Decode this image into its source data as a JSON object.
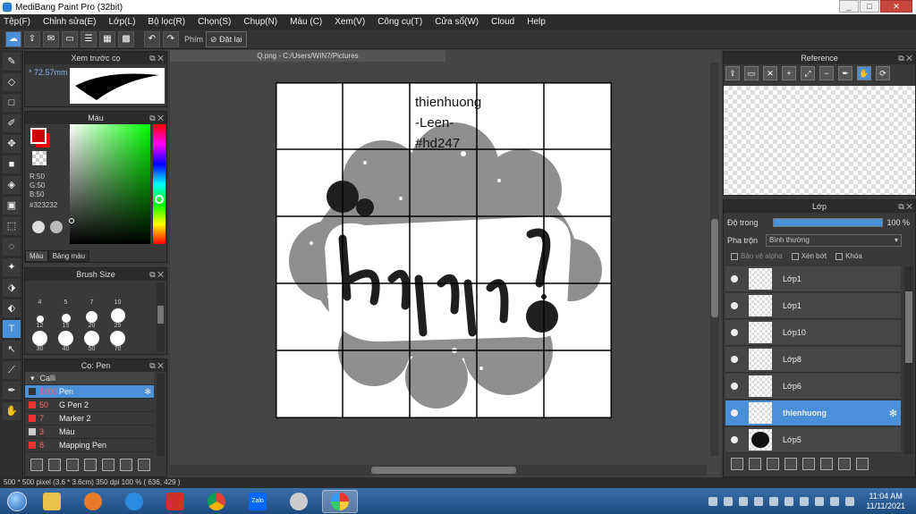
{
  "window": {
    "title": "MediBang Paint Pro (32bit)",
    "controls": [
      "_",
      "□",
      "✕"
    ]
  },
  "menu": [
    "Tệp(F)",
    "Chỉnh sửa(E)",
    "Lớp(L)",
    "Bộ lọc(R)",
    "Chọn(S)",
    "Chụp(N)",
    "Màu (C)",
    "Xem(V)",
    "Công cụ(T)",
    "Cửa sổ(W)",
    "Cloud",
    "Help"
  ],
  "toolbar": {
    "pen_label": "Phím",
    "reset_label": "Đặt lại"
  },
  "preview_panel": {
    "title": "Xem trước cọ",
    "brush_size": "72.57mm"
  },
  "color_panel": {
    "title": "Màu",
    "rgb": [
      "R:50",
      "G:50",
      "B:50"
    ],
    "hex": "#323232",
    "tabs": [
      "Màu",
      "Bảng màu"
    ],
    "fg_color": "#cc0000"
  },
  "brush_size_panel": {
    "title": "Brush Size",
    "sizes": [
      "4",
      "5",
      "7",
      "10",
      "",
      "12",
      "15",
      "20",
      "25",
      "",
      "30",
      "40",
      "50",
      "70",
      ""
    ]
  },
  "brush_panel": {
    "title": "Cọ: Pen",
    "group": "Calli",
    "brushes": [
      {
        "num": "1000",
        "name": "Pen",
        "color": "#e33333",
        "selected": true
      },
      {
        "num": "50",
        "name": "G Pen 2",
        "color": "#e33333",
        "selected": false
      },
      {
        "num": "7",
        "name": "Marker 2",
        "color": "#e33333",
        "selected": false
      },
      {
        "num": "3",
        "name": "Màu",
        "color": "#cccccc",
        "selected": false
      },
      {
        "num": "8",
        "name": "Mapping Pen",
        "color": "#e33333",
        "selected": false
      }
    ]
  },
  "canvas": {
    "tab_title": "Q.png - C:/Users/WIN7/Pictures",
    "text_lines": [
      "thienhuong",
      "-Leen-",
      "#hd247"
    ]
  },
  "reference_panel": {
    "title": "Reference"
  },
  "layer_panel": {
    "title": "Lớp",
    "opacity_label": "Độ trong",
    "opacity_value": "100 %",
    "opacity_level": 100,
    "blend_label": "Pha trộn",
    "blend_value": "Bình thường",
    "checkboxes": [
      "Bảo vệ alpha",
      "Xén bớt",
      "Khóa"
    ],
    "layers": [
      {
        "name": "Lớp1",
        "selected": false
      },
      {
        "name": "Lớp1",
        "selected": false
      },
      {
        "name": "Lớp10",
        "selected": false
      },
      {
        "name": "Lớp8",
        "selected": false
      },
      {
        "name": "Lớp6",
        "selected": false
      },
      {
        "name": "thienhuong",
        "selected": true
      },
      {
        "name": "Lớp5",
        "selected": false
      }
    ]
  },
  "status": {
    "text": "500 * 500 pixel  (3.6 * 3.6cm)  350 dpi  100 %  ( 636, 429 )"
  },
  "taskbar": {
    "time": "11:04 AM",
    "date": "11/11/2021",
    "zalo_label": "Zalo"
  },
  "colors": {
    "accent": "#4a90d9",
    "panel": "#393939",
    "canvas_bg": "#454545"
  }
}
